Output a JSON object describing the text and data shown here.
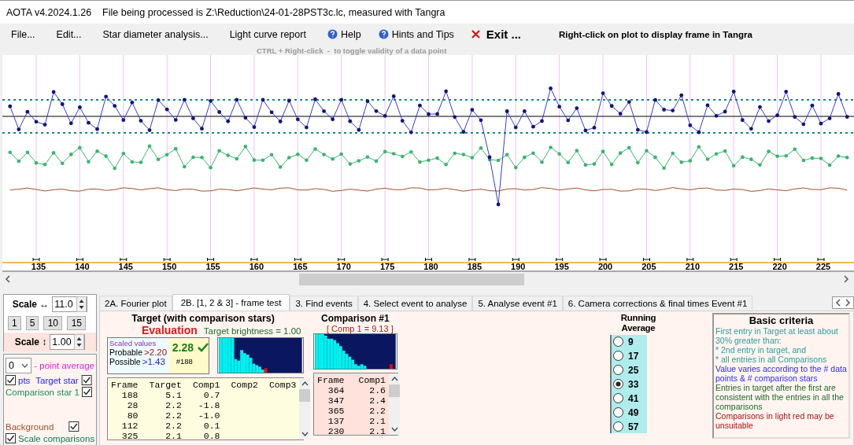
{
  "window": {
    "title": "AOTA v4.2024.1.26    File being processed is Z:\\Reduction\\24-01-28PST3c.lc, measured with Tangra"
  },
  "menu": [
    {
      "label": "File...",
      "kind": "plain"
    },
    {
      "label": "Edit...",
      "kind": "plain"
    },
    {
      "label": "Star diameter analysis...",
      "kind": "plain"
    },
    {
      "label": "Light curve report",
      "kind": "plain"
    },
    {
      "label": "Help",
      "kind": "help"
    },
    {
      "label": "Hints and Tips",
      "kind": "help"
    },
    {
      "label": "Exit ...",
      "kind": "exit"
    }
  ],
  "plot_hint": "Right-click on plot to display frame in Tangra",
  "toggle_hint": "CTRL + Right-click  -  to toggle validity of a data point",
  "plot": {
    "axis_labels": [
      "135",
      "140",
      "145",
      "150",
      "155",
      "160",
      "165",
      "170",
      "175",
      "180",
      "185",
      "190",
      "195",
      "200",
      "205",
      "210",
      "215",
      "220",
      "225"
    ]
  },
  "scale_panel": {
    "horizontal_label": "Scale ↔",
    "horizontal_value": "11.0",
    "presets": [
      "1",
      "5",
      "10",
      "15"
    ],
    "vertical_label": "Scale ↕",
    "vertical_value": "1.00"
  },
  "display_panel": {
    "point_average": "0",
    "point_average_label": "- point average",
    "pts": {
      "label": "pts",
      "checked": true
    },
    "items": [
      {
        "label": "Target star",
        "kind": "series",
        "color": "#1b1bff",
        "checked": true
      },
      {
        "label": "Comparison star 1",
        "kind": "series",
        "color": "#14905a",
        "checked": true
      },
      {
        "label": "Background",
        "kind": "series",
        "color": "#a0522d",
        "checked": true
      },
      {
        "label": "Scale comparisons",
        "kind": "option",
        "color": "#0d7a55",
        "checked": true
      }
    ]
  },
  "tabs": [
    {
      "label": "2A. Fourier plot",
      "selected": false
    },
    {
      "label": "2B. [1, 2 & 3] - frame test",
      "selected": true
    },
    {
      "label": "3. Find events",
      "selected": false
    },
    {
      "label": "4. Select event to analyse",
      "selected": false
    },
    {
      "label": "5. Analyse event #1",
      "selected": false
    },
    {
      "label": "6. Camera corrections & final times Event #1",
      "selected": false
    }
  ],
  "frame_test": {
    "target_title": "Target (with comparison stars)",
    "evaluation": "Evaluation",
    "brightness": "Target  brightness = 1.00",
    "scaled": {
      "heading": "Scaled values",
      "probable_label": "Probable",
      "probable_value": ">2.20",
      "possible_label": "Possible",
      "possible_value": ">1.43",
      "score": "2.28",
      "passed": true,
      "frame": "#188"
    },
    "target_table": {
      "unsuitable": false,
      "columns": [
        "Frame",
        "Target",
        "Comp1",
        "Comp2",
        "Comp3"
      ],
      "rows": [
        [
          "188",
          "5.1",
          "0.7",
          "",
          ""
        ],
        [
          "28",
          "2.2",
          "-1.8",
          "",
          ""
        ],
        [
          "80",
          "2.2",
          "-1.0",
          "",
          ""
        ],
        [
          "112",
          "2.2",
          "0.1",
          "",
          ""
        ],
        [
          "325",
          "2.1",
          "0.8",
          "",
          ""
        ]
      ]
    },
    "comparison_title": "Comparison #1",
    "comparison_value": "[ Comp 1 = 9.13 ]",
    "comparison_table": {
      "unsuitable": true,
      "columns": [
        "Frame",
        "Comp1"
      ],
      "rows": [
        [
          "364",
          "2.6"
        ],
        [
          "347",
          "2.4"
        ],
        [
          "365",
          "2.2"
        ],
        [
          "137",
          "2.1"
        ],
        [
          "230",
          "2.1"
        ]
      ]
    },
    "running_average": {
      "title": "Running Average",
      "options": [
        {
          "label": "9",
          "selected": false
        },
        {
          "label": "17",
          "selected": false
        },
        {
          "label": "25",
          "selected": false
        },
        {
          "label": "33",
          "selected": true
        },
        {
          "label": "41",
          "selected": false
        },
        {
          "label": "49",
          "selected": false
        },
        {
          "label": "57",
          "selected": false
        }
      ]
    },
    "criteria": {
      "title": "Basic criteria",
      "paragraphs": [
        {
          "text": "First entry in Target at least about 30% greater than:\n*  2nd  entry in target, and\n*  all entries in all Comparisons",
          "color": "#2a9d9d"
        },
        {
          "text": "Value varies according to the # data points & # comparison stars",
          "color": "#2b2bff"
        },
        {
          "text": "Entries in target after the first are consistent with the entries in all the comparisons",
          "color": "#1d6b2a"
        },
        {
          "text": "Comparisons in light red may be unsuitable",
          "color": "#b01010"
        }
      ]
    }
  }
}
